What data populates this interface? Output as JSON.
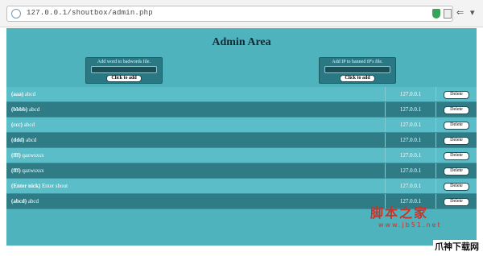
{
  "browser": {
    "url": "127.0.0.1/shoutbox/admin.php"
  },
  "page": {
    "title": "Admin Area",
    "badwords_form": {
      "label": "Add word to badwords file.",
      "input_value": "",
      "button": "Click to add"
    },
    "banned_ip_form": {
      "label": "Add IP to banned IP's file.",
      "input_value": "",
      "button": "Click to add"
    },
    "delete_label": "Delete",
    "messages": [
      {
        "nick": "(aaa)",
        "text": " abcd",
        "ip": "127.0.0.1"
      },
      {
        "nick": "(bbbb)",
        "text": " abcd",
        "ip": "127.0.0.1"
      },
      {
        "nick": "(ccc)",
        "text": " abcd",
        "ip": "127.0.0.1"
      },
      {
        "nick": "(ddd)",
        "text": " abcd",
        "ip": "127.0.0.1"
      },
      {
        "nick": "(fff)",
        "text": " qazwsxsx",
        "ip": "127.0.0.1"
      },
      {
        "nick": "(fff)",
        "text": " qazwsxsx",
        "ip": "127.0.0.1"
      },
      {
        "nick": "(Enter nick)",
        "text": " Enter shout",
        "ip": "127.0.0.1"
      },
      {
        "nick": "(abcd)",
        "text": " abcd",
        "ip": "127.0.0.1"
      }
    ]
  },
  "watermark": {
    "main": "脚本之家",
    "sub": "www.jb51.net",
    "corner": "爪神下载网"
  },
  "colors": {
    "page_bg": "#4fb3be",
    "row_dark": "#2f7c87",
    "row_light": "#5bbdc7",
    "watermark": "#c8342a"
  }
}
